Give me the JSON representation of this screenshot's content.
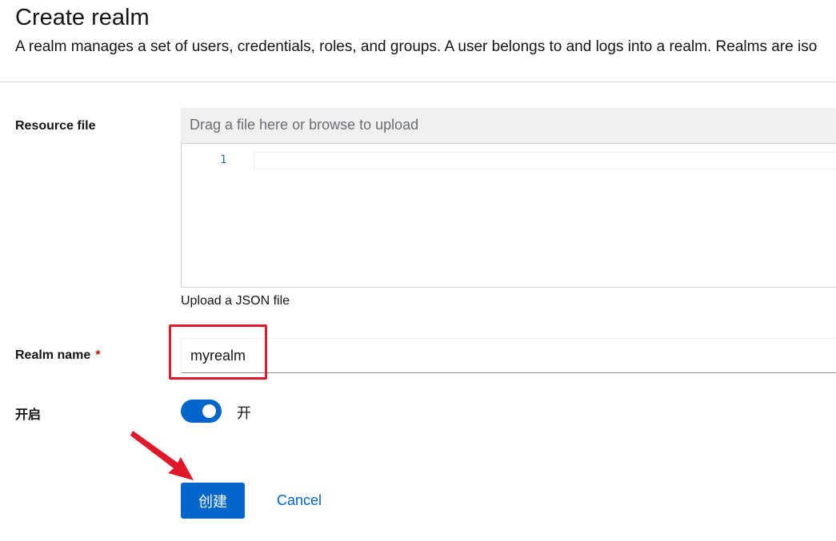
{
  "header": {
    "title": "Create realm",
    "description": "A realm manages a set of users, credentials, roles, and groups. A user belongs to and logs into a realm. Realms are iso"
  },
  "resource_file": {
    "label": "Resource file",
    "placeholder": "Drag a file here or browse to upload",
    "editor_line_number": "1",
    "helper": "Upload a JSON file"
  },
  "realm_name": {
    "label": "Realm name",
    "required_mark": "*",
    "value": "myrealm"
  },
  "enabled": {
    "label": "开启",
    "state_label": "开",
    "checked": true
  },
  "actions": {
    "create_label": "创建",
    "cancel_label": "Cancel"
  },
  "colors": {
    "primary": "#0066cc",
    "annotation": "#e0192a",
    "required": "#c9190b"
  },
  "annotations": {
    "highlight": "red-box-around-realm-name",
    "arrow": "red-arrow-pointing-to-create-button"
  }
}
